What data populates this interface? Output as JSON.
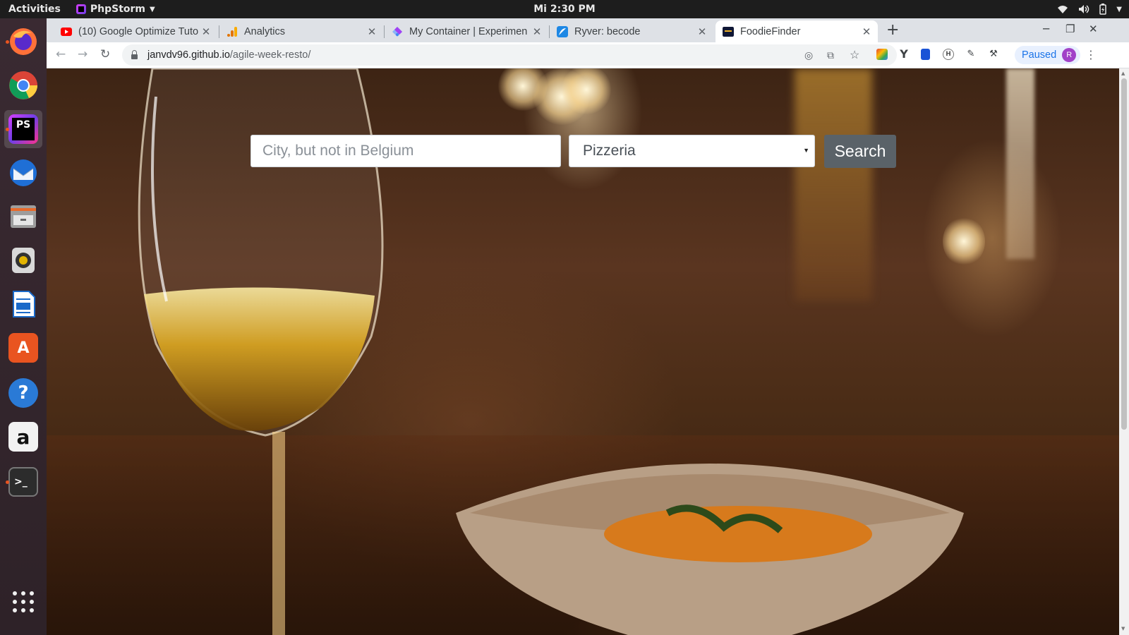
{
  "system": {
    "activities": "Activities",
    "app_name": "PhpStorm",
    "clock": "Mi  2:30 PM"
  },
  "dock": {
    "items": [
      {
        "name": "firefox",
        "icon": "firefox-icon"
      },
      {
        "name": "chrome",
        "icon": "chrome-icon"
      },
      {
        "name": "phpstorm",
        "icon": "phpstorm-icon",
        "label": "PS"
      },
      {
        "name": "thunderbird",
        "icon": "mail-icon"
      },
      {
        "name": "files",
        "icon": "files-icon"
      },
      {
        "name": "rhythmbox",
        "icon": "speaker-icon"
      },
      {
        "name": "writer",
        "icon": "document-icon"
      },
      {
        "name": "software",
        "icon": "store-icon",
        "label": "A"
      },
      {
        "name": "help",
        "icon": "help-icon",
        "label": "?"
      },
      {
        "name": "amazon",
        "icon": "amazon-icon",
        "label": "a"
      },
      {
        "name": "terminal",
        "icon": "terminal-icon",
        "label": ">_"
      }
    ]
  },
  "browser": {
    "tabs": [
      {
        "title": "(10) Google Optimize Tuto",
        "favicon": "youtube-icon"
      },
      {
        "title": "Analytics",
        "favicon": "analytics-icon"
      },
      {
        "title": "My Container | Experimen",
        "favicon": "tagmanager-icon"
      },
      {
        "title": "Ryver: becode",
        "favicon": "ryver-icon"
      },
      {
        "title": "FoodieFinder",
        "favicon": "foodiefinder-icon"
      }
    ],
    "new_tab": "+",
    "url_host": "janvdv96.github.io",
    "url_path": "/agile-week-resto/",
    "profile_status": "Paused",
    "profile_initial": "R"
  },
  "page": {
    "search_placeholder": "City, but not in Belgium",
    "search_value": "",
    "type_selected": "Pizzeria",
    "search_button": "Search"
  },
  "colors": {
    "search_button_bg": "#5a6268",
    "paused_chip_bg": "#e8f0fe",
    "accent_blue": "#1a73e8"
  }
}
